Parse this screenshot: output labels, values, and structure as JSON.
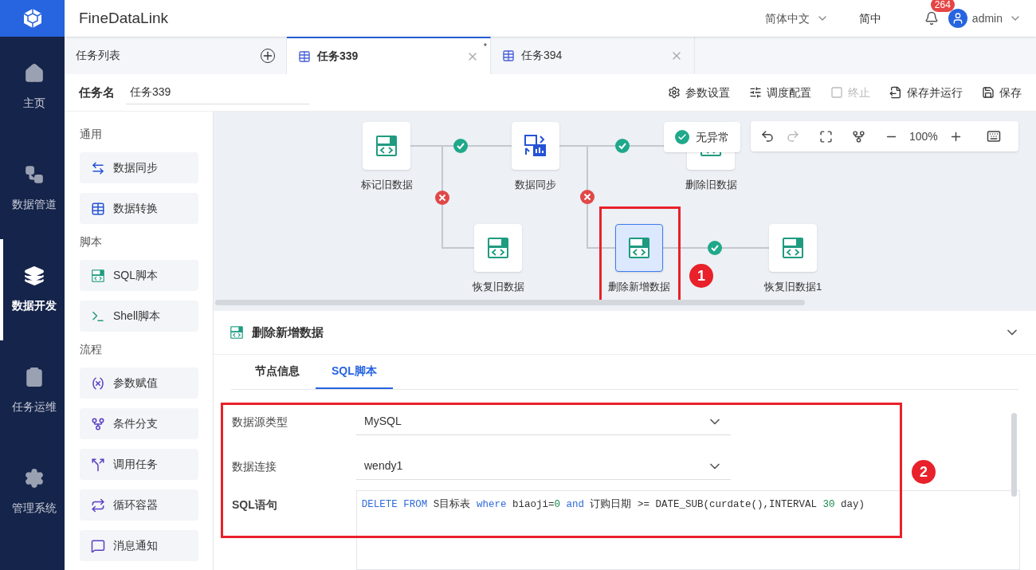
{
  "header": {
    "app_name": "FineDataLink",
    "language": "简体中文",
    "locale_short": "简中",
    "notifications": "264",
    "user": "admin"
  },
  "nav": [
    {
      "label": "主页",
      "kind": "home",
      "selected": false
    },
    {
      "label": "数据管道",
      "kind": "pipe",
      "selected": false
    },
    {
      "label": "数据开发",
      "kind": "dev",
      "selected": true
    },
    {
      "label": "任务运维",
      "kind": "ops",
      "selected": false
    },
    {
      "label": "管理系统",
      "kind": "gear",
      "selected": false
    }
  ],
  "tabs": [
    {
      "label": "任务列表",
      "kind": "list",
      "selected": false
    },
    {
      "label": "任务339",
      "kind": "task",
      "selected": true,
      "unsaved_mark": "*"
    },
    {
      "label": "任务394",
      "kind": "task",
      "selected": false
    }
  ],
  "task_name": {
    "label": "任务名",
    "value": "任务339"
  },
  "actions": [
    {
      "label": "参数设置",
      "kind": "gear",
      "disabled": false
    },
    {
      "label": "调度配置",
      "kind": "sliders",
      "disabled": false
    },
    {
      "label": "终止",
      "kind": "stop",
      "disabled": true
    },
    {
      "label": "保存并运行",
      "kind": "run",
      "disabled": false
    },
    {
      "label": "保存",
      "kind": "save",
      "disabled": false
    }
  ],
  "palette": [
    {
      "group": "通用",
      "items": [
        {
          "label": "数据同步",
          "kind": "sync"
        },
        {
          "label": "数据转换",
          "kind": "transform"
        }
      ]
    },
    {
      "group": "脚本",
      "items": [
        {
          "label": "SQL脚本",
          "kind": "sql"
        },
        {
          "label": "Shell脚本",
          "kind": "shell"
        }
      ]
    },
    {
      "group": "流程",
      "items": [
        {
          "label": "参数赋值",
          "kind": "param"
        },
        {
          "label": "条件分支",
          "kind": "branch"
        },
        {
          "label": "调用任务",
          "kind": "call"
        },
        {
          "label": "循环容器",
          "kind": "loop"
        },
        {
          "label": "消息通知",
          "kind": "notify"
        }
      ]
    }
  ],
  "canvas": {
    "status": "无异常",
    "zoom": "100%",
    "nodes": [
      {
        "label": "标记旧数据",
        "kind": "sql",
        "selected": false
      },
      {
        "label": "数据同步",
        "kind": "sync",
        "selected": false
      },
      {
        "label": "删除旧数据",
        "kind": "sql",
        "selected": false
      },
      {
        "label": "恢复旧数据",
        "kind": "sql",
        "selected": false
      },
      {
        "label": "删除新增数据",
        "kind": "sql",
        "selected": true
      },
      {
        "label": "恢复旧数据1",
        "kind": "sql",
        "selected": false
      }
    ],
    "edges": [
      {
        "kind": "success"
      },
      {
        "kind": "success"
      },
      {
        "kind": "failure"
      },
      {
        "kind": "failure"
      },
      {
        "kind": "success"
      }
    ]
  },
  "annotations": [
    "1",
    "2"
  ],
  "detail": {
    "title": "删除新增数据",
    "tabs": [
      {
        "label": "节点信息",
        "selected": false
      },
      {
        "label": "SQL脚本",
        "selected": true
      }
    ],
    "fields": [
      {
        "label": "数据源类型",
        "value": "MySQL"
      },
      {
        "label": "数据连接",
        "value": "wendy1"
      }
    ],
    "sql_label": "SQL语句",
    "sql": [
      {
        "text": "DELETE FROM ",
        "kind": "keyword"
      },
      {
        "text": "S目标表 ",
        "kind": "plain"
      },
      {
        "text": "where ",
        "kind": "keyword"
      },
      {
        "text": "biaoji=",
        "kind": "plain"
      },
      {
        "text": "0 ",
        "kind": "number"
      },
      {
        "text": "and ",
        "kind": "keyword"
      },
      {
        "text": "订购日期 >= DATE_SUB(curdate(),INTERVAL ",
        "kind": "plain"
      },
      {
        "text": "30 ",
        "kind": "number"
      },
      {
        "text": "day)",
        "kind": "plain"
      }
    ]
  }
}
